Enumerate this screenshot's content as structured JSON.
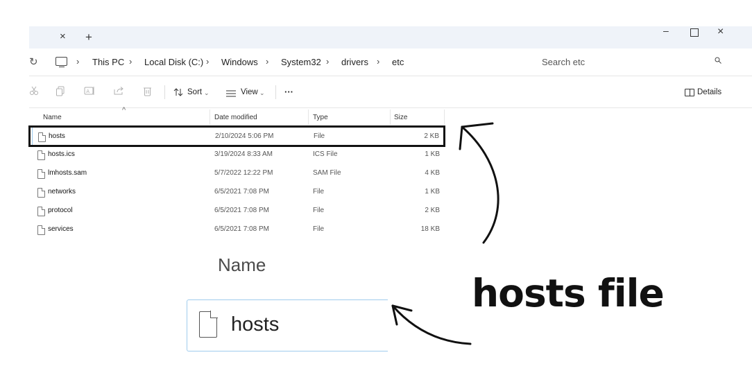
{
  "window": {
    "tab_close_glyph": "×",
    "tab_new_glyph": "+",
    "minimize_glyph": "–",
    "close_glyph": "×"
  },
  "address": {
    "refresh_glyph": "↻",
    "breadcrumbs": [
      "This PC",
      "Local Disk (C:)",
      "Windows",
      "System32",
      "drivers",
      "etc"
    ],
    "separator": "›"
  },
  "search": {
    "placeholder": "Search etc"
  },
  "toolbar": {
    "sort_label": "Sort",
    "view_label": "View",
    "more_label": "···",
    "details_label": "Details"
  },
  "file_list": {
    "columns": {
      "name": "Name",
      "date": "Date modified",
      "type": "Type",
      "size": "Size"
    },
    "rows": [
      {
        "name": "hosts",
        "date": "2/10/2024 5:06 PM",
        "type": "File",
        "size": "2 KB"
      },
      {
        "name": "hosts.ics",
        "date": "3/19/2024 8:33 AM",
        "type": "ICS File",
        "size": "1 KB"
      },
      {
        "name": "lmhosts.sam",
        "date": "5/7/2022 12:22 PM",
        "type": "SAM File",
        "size": "4 KB"
      },
      {
        "name": "networks",
        "date": "6/5/2021 7:08 PM",
        "type": "File",
        "size": "1 KB"
      },
      {
        "name": "protocol",
        "date": "6/5/2021 7:08 PM",
        "type": "File",
        "size": "2 KB"
      },
      {
        "name": "services",
        "date": "6/5/2021 7:08 PM",
        "type": "File",
        "size": "18 KB"
      }
    ]
  },
  "callout": {
    "zoom_header": "Name",
    "zoom_file": "hosts",
    "caption": "hosts file"
  },
  "colors": {
    "titlebar": "#eff3f9",
    "selection_border": "#99c9ef",
    "highlight": "#111111"
  }
}
